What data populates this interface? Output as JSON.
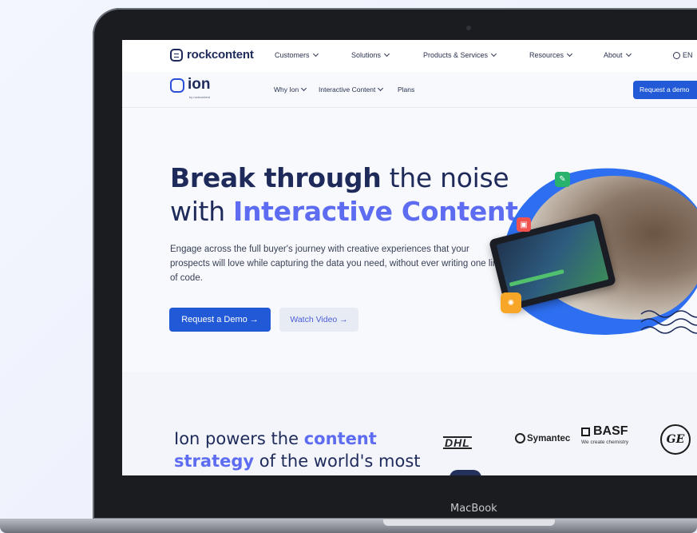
{
  "device": {
    "label": "MacBook"
  },
  "top_nav": {
    "brand": "rockcontent",
    "items": [
      {
        "label": "Customers"
      },
      {
        "label": "Solutions"
      },
      {
        "label": "Products & Services"
      },
      {
        "label": "Resources"
      },
      {
        "label": "About"
      }
    ],
    "language": "EN"
  },
  "sub_nav": {
    "brand": "ion",
    "brand_sub": "by rockcontent",
    "items": [
      {
        "label": "Why Ion"
      },
      {
        "label": "Interactive Content"
      },
      {
        "label": "Plans"
      }
    ],
    "cta": "Request a demo"
  },
  "hero": {
    "title_bold": "Break through",
    "title_rest": " the noise",
    "title_line2_a": "with ",
    "title_line2_highlight": "Interactive Content",
    "description": "Engage across the full buyer's journey with creative experiences that your prospects will love while capturing the data you need, without ever writing one line of code.",
    "primary_button": "Request a Demo →",
    "secondary_button": "Watch Video →"
  },
  "logos_section": {
    "line1_a": "Ion powers the ",
    "line1_highlight": "content",
    "line2_highlight": "strategy",
    "line2_rest": " of the world's most",
    "logos": {
      "dhl": "DHL",
      "symantec": "Symantec",
      "basf": "BASF",
      "basf_tagline": "We create chemistry",
      "ge": "GE"
    }
  },
  "colors": {
    "accent": "#2159d6",
    "highlight": "#5d6cf0",
    "navy": "#1e2a5a"
  }
}
